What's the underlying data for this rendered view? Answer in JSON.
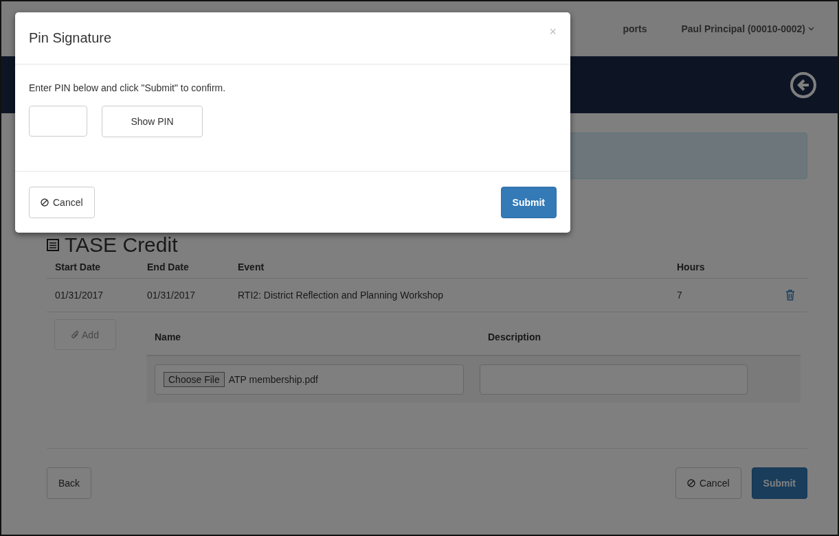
{
  "nav": {
    "items": [
      {
        "label": "ports"
      }
    ],
    "user": "Paul Principal (00010-0002)"
  },
  "section": {
    "title": "TASE Credit"
  },
  "table": {
    "columns": [
      "Start Date",
      "End Date",
      "Event",
      "Hours"
    ],
    "rows": [
      {
        "cells": [
          "01/31/2017",
          "01/31/2017",
          "RTI2: District Reflection and Planning Workshop",
          "7"
        ]
      }
    ]
  },
  "attachments": {
    "add_button": {
      "label": "Add",
      "disabled": true
    },
    "columns": [
      "Name",
      "Description"
    ],
    "rows": [
      {
        "choose_file": "Choose File",
        "file_name": "ATP membership.pdf"
      }
    ]
  },
  "footer": {
    "back": "Back",
    "cancel": "Cancel",
    "submit": "Submit"
  },
  "modal": {
    "title": "Pin Signature",
    "close": "×",
    "message": "Enter PIN below and click \"Submit\" to confirm.",
    "show_pin": "Show PIN",
    "cancel": "Cancel",
    "submit": "Submit"
  }
}
